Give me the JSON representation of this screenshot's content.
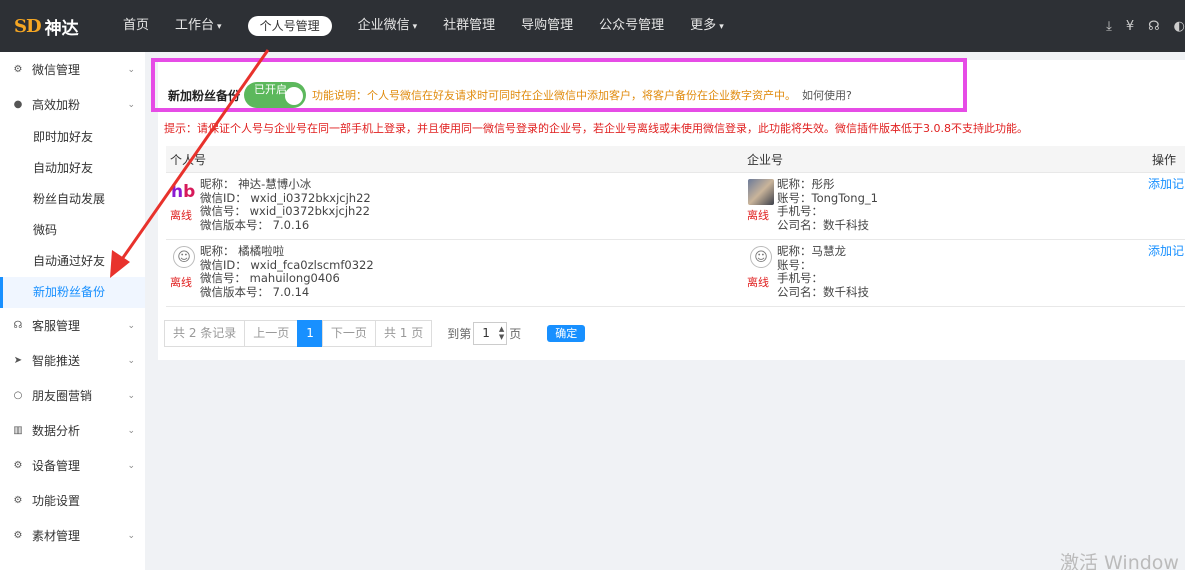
{
  "brand": {
    "mark": "SD",
    "name": "神达"
  },
  "topnav": {
    "items": [
      {
        "label": "首页"
      },
      {
        "label": "工作台",
        "caret": "⌄"
      },
      {
        "label": "个人号管理",
        "active": true
      },
      {
        "label": "企业微信",
        "caret": "⌄"
      },
      {
        "label": "社群管理"
      },
      {
        "label": "导购管理"
      },
      {
        "label": "公众号管理"
      },
      {
        "label": "更多",
        "caret": "⌄"
      }
    ]
  },
  "sidebar": {
    "groups": [
      {
        "label": "微信管理",
        "icon": "gears-icon"
      },
      {
        "label": "高效加粉",
        "icon": "user-icon",
        "children": [
          "即时加好友",
          "自动加好友",
          "粉丝自动发展",
          "微码",
          "自动通过好友",
          "新加粉丝备份"
        ],
        "active_child": "新加粉丝备份"
      },
      {
        "label": "客服管理",
        "icon": "headset-icon"
      },
      {
        "label": "智能推送",
        "icon": "send-icon"
      },
      {
        "label": "朋友圈营销",
        "icon": "chat-icon"
      },
      {
        "label": "数据分析",
        "icon": "chart-icon"
      },
      {
        "label": "设备管理",
        "icon": "gears-icon"
      },
      {
        "label": "功能设置",
        "icon": "gears-icon"
      },
      {
        "label": "素材管理",
        "icon": "gears-icon"
      }
    ]
  },
  "setting": {
    "label": "新加粉丝备份",
    "toggle_text": "已开启",
    "toggle_on": true,
    "note": "功能说明：个人号微信在好友请求时可同时在企业微信中添加客户，将客户备份在企业数字资产中。",
    "how_to": "如何使用?"
  },
  "tip": "提示：请保证个人号与企业号在同一部手机上登录，并且使用同一微信号登录的企业号，若企业号离线或未使用微信登录，此功能将失效。微信插件版本低于3.0.8不支持此功能。",
  "table": {
    "headers": [
      "个人号",
      "企业号",
      "操作"
    ],
    "rows": [
      {
        "personal": {
          "nickname": "昵称：  神达-慧博小冰",
          "wxid": "微信ID：  wxid_i0372bkxjcjh22",
          "wxno": "微信号：  wxid_i0372bkxjcjh22",
          "version": "微信版本号：  7.0.16",
          "status": "离线"
        },
        "corp": {
          "nickname": "昵称：彤彤",
          "account": "账号：TongTong_1",
          "phone": "手机号：",
          "company": "公司名：数千科技",
          "status": "离线"
        },
        "action": "添加记"
      },
      {
        "personal": {
          "nickname": "昵称：  橘橘啦啦",
          "wxid": "微信ID：  wxid_fca0zlscmf0322",
          "wxno": "微信号：  mahuilong0406",
          "version": "微信版本号：  7.0.14",
          "status": "离线"
        },
        "corp": {
          "nickname": "昵称：马慧龙",
          "account": "账号：",
          "phone": "手机号：",
          "company": "公司名：数千科技",
          "status": "离线"
        },
        "action": "添加记"
      }
    ]
  },
  "pager": {
    "total": "共 2 条记录",
    "prev": "上一页",
    "current": "1",
    "next": "下一页",
    "pages": "共 1 页",
    "goto_prefix": "到第",
    "goto_value": "1",
    "goto_suffix": "页",
    "confirm": "确定"
  },
  "watermark": "激活 Window",
  "colors": {
    "nav_bg": "#2d3035",
    "accent": "#1890ff",
    "highlight": "#e64ce6",
    "toggle_on": "#5cb85c",
    "warning": "#e02020",
    "arrow": "#e8322c"
  }
}
